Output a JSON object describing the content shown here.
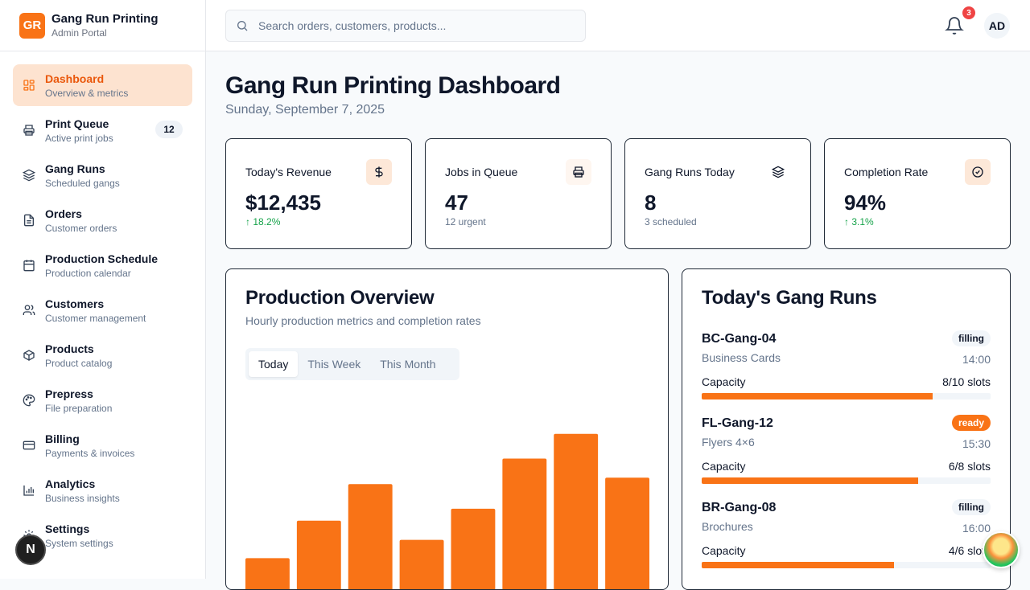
{
  "brand": {
    "logo": "GR",
    "title": "Gang Run Printing",
    "subtitle": "Admin Portal"
  },
  "sidebar": {
    "items": [
      {
        "label": "Dashboard",
        "sub": "Overview & metrics",
        "icon": "dashboard-icon"
      },
      {
        "label": "Print Queue",
        "sub": "Active print jobs",
        "icon": "printer-icon",
        "badge": "12"
      },
      {
        "label": "Gang Runs",
        "sub": "Scheduled gangs",
        "icon": "layers-icon"
      },
      {
        "label": "Orders",
        "sub": "Customer orders",
        "icon": "file-text-icon"
      },
      {
        "label": "Production Schedule",
        "sub": "Production calendar",
        "icon": "calendar-icon"
      },
      {
        "label": "Customers",
        "sub": "Customer management",
        "icon": "users-icon"
      },
      {
        "label": "Products",
        "sub": "Product catalog",
        "icon": "package-icon"
      },
      {
        "label": "Prepress",
        "sub": "File preparation",
        "icon": "palette-icon"
      },
      {
        "label": "Billing",
        "sub": "Payments & invoices",
        "icon": "credit-card-icon"
      },
      {
        "label": "Analytics",
        "sub": "Business insights",
        "icon": "bar-chart-icon"
      },
      {
        "label": "Settings",
        "sub": "System settings",
        "icon": "gear-icon"
      }
    ]
  },
  "topbar": {
    "search_placeholder": "Search orders, customers, products...",
    "notifications": "3",
    "avatar": "AD"
  },
  "page": {
    "title": "Gang Run Printing Dashboard",
    "date": "Sunday, September 7, 2025"
  },
  "stats": [
    {
      "label": "Today's Revenue",
      "value": "$12,435",
      "sub": "↑ 18.2%",
      "icon": "dollar-icon"
    },
    {
      "label": "Jobs in Queue",
      "value": "47",
      "sub": "12 urgent",
      "icon": "printer-icon"
    },
    {
      "label": "Gang Runs Today",
      "value": "8",
      "sub": "3 scheduled",
      "icon": "layers-icon"
    },
    {
      "label": "Completion Rate",
      "value": "94%",
      "sub": "↑ 3.1%",
      "icon": "check-circle-icon"
    }
  ],
  "production": {
    "title": "Production Overview",
    "subtitle": "Hourly production metrics and completion rates",
    "tabs": [
      "Today",
      "This Week",
      "This Month"
    ],
    "active_tab": "Today"
  },
  "chart_data": {
    "type": "bar",
    "values": [
      41,
      88,
      134,
      64,
      103,
      166,
      197,
      142
    ],
    "ylim": [
      0,
      220
    ],
    "color": "#f97316"
  },
  "gang_runs": {
    "title": "Today's Gang Runs",
    "items": [
      {
        "name": "BC-Gang-04",
        "type": "Business Cards",
        "status": "filling",
        "time": "14:00",
        "cap_label": "Capacity",
        "capacity": "8/10 slots",
        "fill": 0.8
      },
      {
        "name": "FL-Gang-12",
        "type": "Flyers 4×6",
        "status": "ready",
        "time": "15:30",
        "cap_label": "Capacity",
        "capacity": "6/8 slots",
        "fill": 0.75
      },
      {
        "name": "BR-Gang-08",
        "type": "Brochures",
        "status": "filling",
        "time": "16:00",
        "cap_label": "Capacity",
        "capacity": "4/6 slots",
        "fill": 0.667
      }
    ]
  },
  "colors": {
    "accent": "#f97316",
    "accent_soft": "#fde3d0",
    "success": "#16a34a",
    "danger": "#ef4444"
  }
}
